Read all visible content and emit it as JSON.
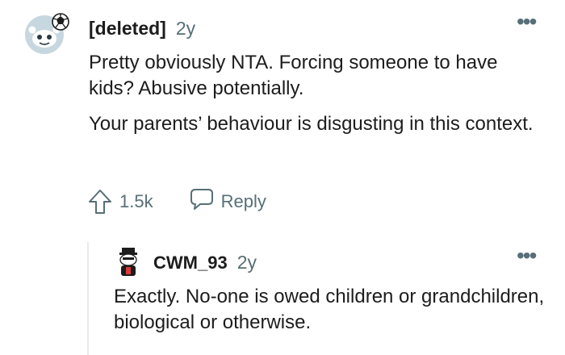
{
  "comments": [
    {
      "author": "[deleted]",
      "age": "2y",
      "paragraphs": [
        "Pretty obviously NTA. Forcing someone to have kids? Abusive potentially.",
        "Your parents’ behaviour is disgusting in this context."
      ],
      "score": "1.5k",
      "reply_label": "Reply",
      "more_label": "•••"
    },
    {
      "author": "CWM_93",
      "age": "2y",
      "paragraphs": [
        "Exactly. No-one is owed children or grandchildren, biological or otherwise."
      ],
      "more_label": "•••"
    }
  ],
  "colors": {
    "text": "#1c1c1c",
    "meta": "#576f76",
    "thread_line": "#e5ebee",
    "avatar_bg": "#c7d7df"
  },
  "icons": {
    "upvote": "upvote-arrow-icon",
    "reply": "speech-bubble-icon",
    "more": "ellipsis-icon"
  }
}
